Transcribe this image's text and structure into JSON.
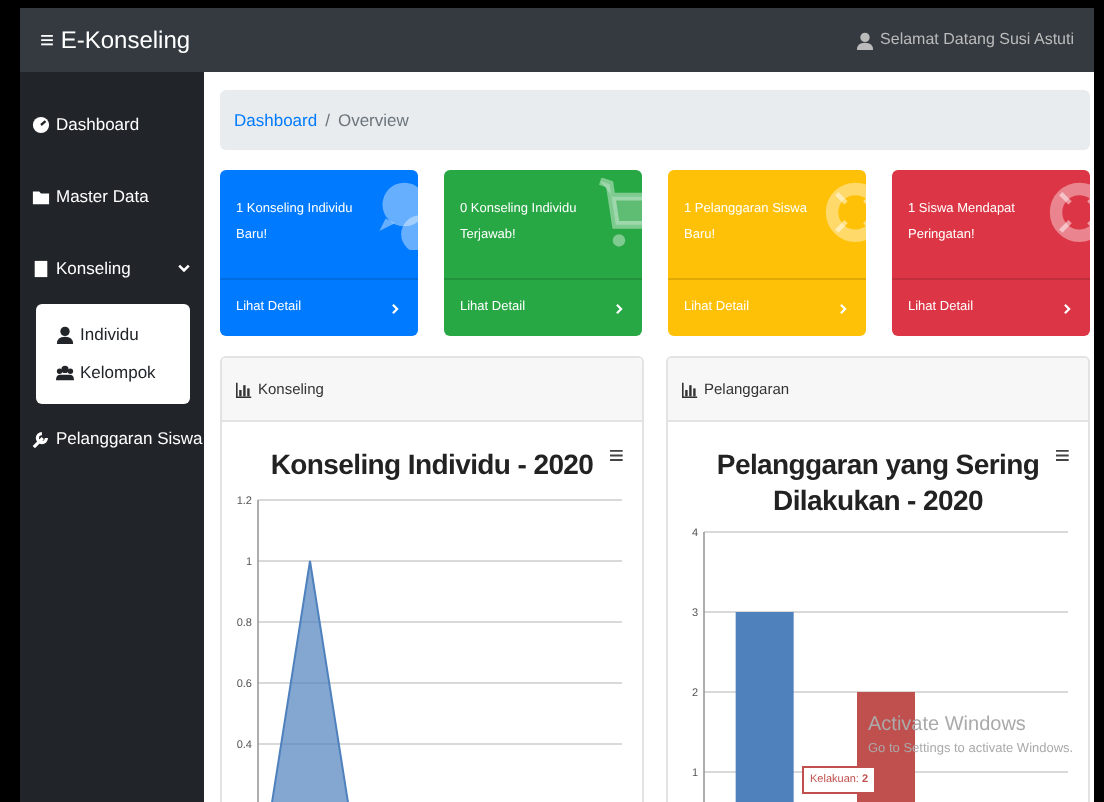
{
  "navbar": {
    "brand_icon": "≡",
    "brand": "E-Konseling",
    "greeting": "Selamat Datang Susi Astuti"
  },
  "sidebar": {
    "items": [
      {
        "label": "Dashboard",
        "selected": false
      },
      {
        "label": "Master Data",
        "selected": false
      },
      {
        "label": "Konseling",
        "selected": false,
        "expanded": true,
        "children": [
          {
            "label": "Individu"
          },
          {
            "label": "Kelompok"
          }
        ]
      },
      {
        "label": "Pelanggaran Siswa",
        "selected": false
      }
    ]
  },
  "breadcrumb": [
    {
      "label": "Dashboard",
      "kind": "link"
    },
    {
      "label": "/",
      "kind": "separator"
    },
    {
      "label": "Overview",
      "kind": "current"
    }
  ],
  "stat_cards": [
    {
      "text": "1 Konseling Individu Baru!",
      "link": "Lihat Detail",
      "color": "#007bff"
    },
    {
      "text": "0 Konseling Individu Terjawab!",
      "link": "Lihat Detail",
      "color": "#28a745"
    },
    {
      "text": "1 Pelanggaran Siswa Baru!",
      "link": "Lihat Detail",
      "color": "#ffc107"
    },
    {
      "text": "1 Siswa Mendapat Peringatan!",
      "link": "Lihat Detail",
      "color": "#dc3545"
    }
  ],
  "panels": [
    {
      "header": "Konseling",
      "menu_icon": "≡",
      "chart_data": {
        "type": "area",
        "title": "Konseling Individu - 2020",
        "grid": true,
        "ylim": [
          0,
          1.2
        ],
        "yticks": [
          0.4,
          0.6,
          0.8,
          1,
          1.2
        ],
        "series": [
          {
            "color": "#4f81bd",
            "values": [
              0,
              1,
              0,
              0,
              0,
              0,
              0,
              0
            ]
          }
        ]
      }
    },
    {
      "header": "Pelanggaran",
      "menu_icon": "≡",
      "chart_data": {
        "type": "bar",
        "title": "Pelanggaran yang Sering Dilakukan - 2020",
        "grid": true,
        "ylim": [
          0,
          4
        ],
        "yticks": [
          1,
          2,
          3,
          4
        ],
        "series": [
          {
            "color": "#4f81bd",
            "values": [
              3,
              null,
              null
            ]
          },
          {
            "color": "#c0504d",
            "values": [
              null,
              2,
              null
            ]
          }
        ],
        "annotations": [
          {
            "text": "Kelakuan: **2**"
          }
        ]
      }
    }
  ],
  "os_notice": {
    "title": "Activate Windows",
    "text": "Go to Settings to activate Windows."
  }
}
